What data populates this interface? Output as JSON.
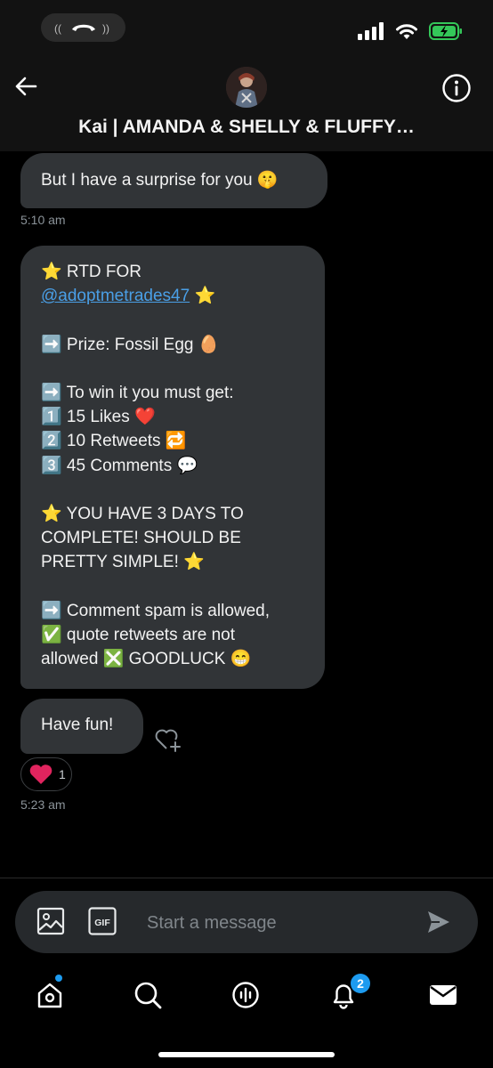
{
  "header": {
    "title": "Kai | AMANDA & SHELLY & FLUFFY…"
  },
  "messages": [
    {
      "lines": [
        "But I have a surprise for you 🤫"
      ],
      "time": "5:10 am"
    },
    {
      "lines": [
        "⭐ RTD FOR",
        "@adoptmetrades47 ⭐",
        "",
        "➡️ Prize: Fossil Egg 🥚",
        "",
        "➡️ To win it you must get:",
        "1️⃣ 15 Likes ❤️",
        "2️⃣ 10 Retweets 🔁",
        "3️⃣ 45 Comments 💬",
        "",
        "⭐ YOU HAVE 3 DAYS TO",
        "COMPLETE! SHOULD BE",
        "PRETTY SIMPLE! ⭐",
        "",
        "➡️ Comment spam is allowed,",
        "✅ quote retweets are not",
        "allowed ❎ GOODLUCK 😁"
      ]
    },
    {
      "lines": [
        "Have fun!"
      ],
      "reaction": {
        "emoji": "❤️",
        "count": "1"
      },
      "time": "5:23 am"
    }
  ],
  "composer": {
    "placeholder": "Start a message",
    "gif_label": "GIF"
  },
  "tabs": {
    "notifications_badge": "2"
  },
  "colors": {
    "bubble": "#313437",
    "accent": "#1d9bf0",
    "link": "#4a9fe6",
    "battery": "#34c759"
  }
}
